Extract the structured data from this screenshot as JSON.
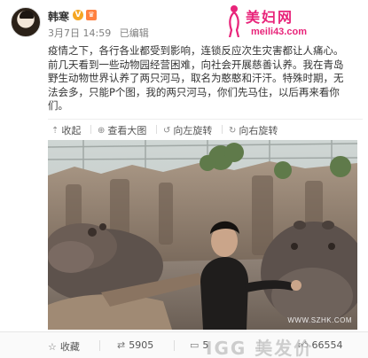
{
  "post": {
    "username": "韩寒",
    "verified_icon": "V",
    "badge_icon": "♛",
    "date": "3月7日 14:59",
    "edited": "已编辑",
    "text_lines": [
      "疫情之下，各行各业都受到影响，连锁反应次生灾害都让人痛心。",
      "前几天看到一些动物园经营困难，向社会开展慈善认养。我在青岛",
      "野生动物世界认养了两只河马，取名为憨憨和汗汗。特殊时期，无",
      "法会多，只能P个图，我的两只河马，你们先马住，以后再来看你",
      "们。"
    ]
  },
  "watermark": {
    "title": "美妇网",
    "url": "meili43.com",
    "photo_site": "WWW.SZHK.COM"
  },
  "toolbar": {
    "collect": "收起",
    "view_large": "查看大图",
    "rotate_left": "向左旋转",
    "rotate_right": "向右旋转"
  },
  "footer": {
    "favorite": "收藏",
    "reposts": "5905",
    "comments": "5",
    "likes": "66554",
    "overlay_text": "IGG 美发价"
  },
  "icons": {
    "collect": "collapse-icon",
    "view_large": "zoom-in-icon",
    "rotate_left": "rotate-left-icon",
    "rotate_right": "rotate-right-icon",
    "favorite": "star-icon",
    "repost": "repost-icon",
    "comment": "comment-icon",
    "like": "thumbs-up-icon"
  },
  "colors": {
    "watermark_pink": "#e8247a",
    "verified_gold": "#f5a623",
    "meta_gray": "#808080"
  }
}
